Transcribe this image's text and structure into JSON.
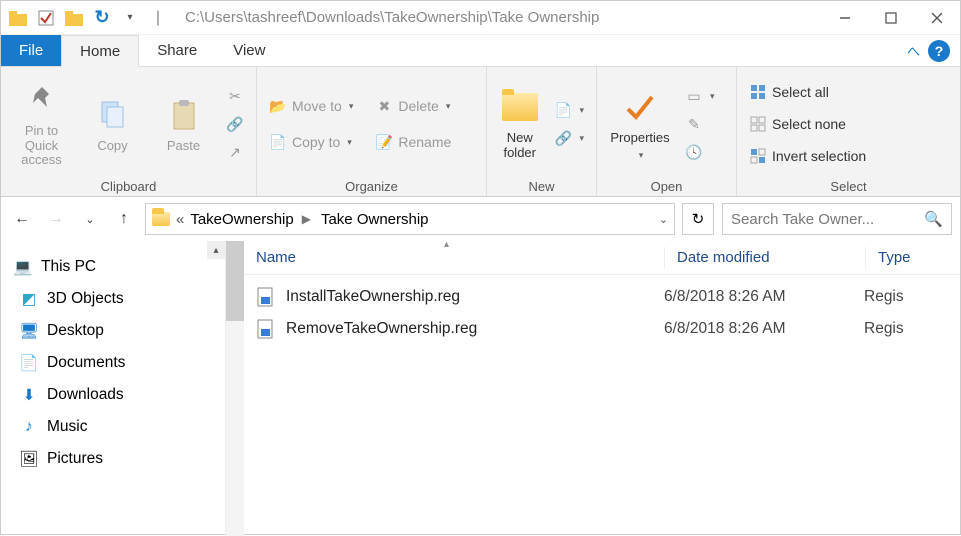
{
  "title_path": "C:\\Users\\tashreef\\Downloads\\TakeOwnership\\Take Ownership",
  "tabs": {
    "file": "File",
    "home": "Home",
    "share": "Share",
    "view": "View"
  },
  "ribbon": {
    "clipboard": {
      "label": "Clipboard",
      "pin": "Pin to Quick access",
      "copy": "Copy",
      "paste": "Paste"
    },
    "organize": {
      "label": "Organize",
      "move": "Move to",
      "copy": "Copy to",
      "delete": "Delete",
      "rename": "Rename"
    },
    "new": {
      "label": "New",
      "folder": "New folder"
    },
    "open": {
      "label": "Open",
      "props": "Properties"
    },
    "select": {
      "label": "Select",
      "all": "Select all",
      "none": "Select none",
      "inv": "Invert selection"
    }
  },
  "breadcrumb": {
    "a": "TakeOwnership",
    "b": "Take Ownership"
  },
  "search_placeholder": "Search Take Owner...",
  "columns": {
    "name": "Name",
    "date": "Date modified",
    "type": "Type"
  },
  "tree": {
    "root": "This PC",
    "items": [
      "3D Objects",
      "Desktop",
      "Documents",
      "Downloads",
      "Music",
      "Pictures"
    ]
  },
  "files": [
    {
      "name": "InstallTakeOwnership.reg",
      "date": "6/8/2018 8:26 AM",
      "type": "Regis"
    },
    {
      "name": "RemoveTakeOwnership.reg",
      "date": "6/8/2018 8:26 AM",
      "type": "Regis"
    }
  ]
}
